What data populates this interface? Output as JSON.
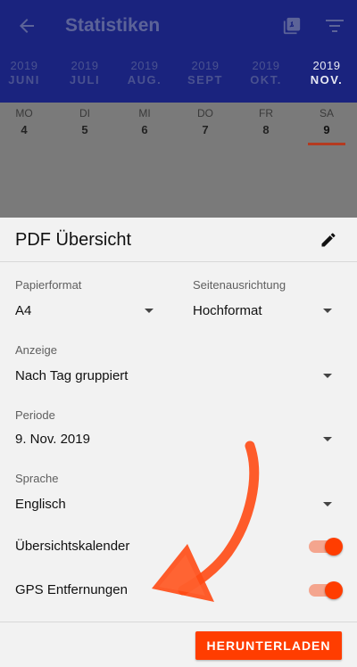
{
  "appbar": {
    "title": "Statistiken"
  },
  "months": [
    {
      "year": "2019",
      "month": "JUNI"
    },
    {
      "year": "2019",
      "month": "JULI"
    },
    {
      "year": "2019",
      "month": "AUG."
    },
    {
      "year": "2019",
      "month": "SEPT"
    },
    {
      "year": "2019",
      "month": "OKT."
    },
    {
      "year": "2019",
      "month": "NOV."
    }
  ],
  "days": [
    {
      "name": "MO",
      "date": "4"
    },
    {
      "name": "DI",
      "date": "5"
    },
    {
      "name": "MI",
      "date": "6"
    },
    {
      "name": "DO",
      "date": "7"
    },
    {
      "name": "FR",
      "date": "8"
    },
    {
      "name": "SA",
      "date": "9"
    }
  ],
  "sheet": {
    "title": "PDF Übersicht",
    "paper_format": {
      "label": "Papierformat",
      "value": "A4"
    },
    "orientation": {
      "label": "Seitenausrichtung",
      "value": "Hochformat"
    },
    "display": {
      "label": "Anzeige",
      "value": "Nach Tag gruppiert"
    },
    "period": {
      "label": "Periode",
      "value": "9. Nov. 2019"
    },
    "language": {
      "label": "Sprache",
      "value": "Englisch"
    },
    "overview_calendar": {
      "label": "Übersichtskalender",
      "on": true
    },
    "gps_distances": {
      "label": "GPS Entfernungen",
      "on": true
    },
    "download_label": "HERUNTERLADEN"
  },
  "colors": {
    "appbar": "#1a237e",
    "accent": "#ff3d00"
  },
  "icons": {
    "back": "arrow-left-icon",
    "pdf": "pdf-icon",
    "filter": "filter-icon",
    "edit": "pencil-icon"
  }
}
